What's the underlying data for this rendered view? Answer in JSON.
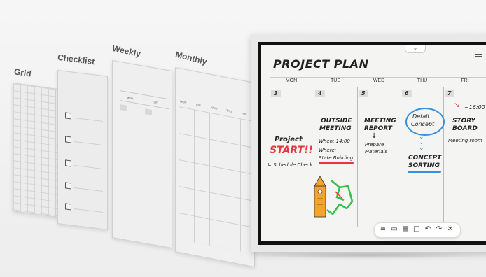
{
  "templates": [
    {
      "label": "Grid"
    },
    {
      "label": "Checklist"
    },
    {
      "label": "Weekly"
    },
    {
      "label": "Monthly"
    }
  ],
  "weekly_days": [
    "MON",
    "TUE"
  ],
  "monthly_days": [
    "MON",
    "TUE",
    "WED",
    "THU",
    "FRI"
  ],
  "board": {
    "title": "PROJECT PLAN",
    "days": [
      "MON",
      "TUE",
      "WED",
      "THU",
      "FRI"
    ],
    "dates": [
      "3",
      "4",
      "5",
      "6",
      "7"
    ],
    "mon": {
      "line1": "Project",
      "line2": "START!!",
      "line3": "Schedule Check"
    },
    "tue": {
      "line1": "OUTSIDE",
      "line2": "MEETING",
      "line3": "When: 14:00",
      "line4": "Where:",
      "line5": "State Building"
    },
    "wed": {
      "line1": "MEETING",
      "line2": "REPORT",
      "line3": "Prepare",
      "line4": "Materials"
    },
    "thu": {
      "line1": "Detail",
      "line2": "Concept",
      "line3": "CONCEPT",
      "line4": "SORTING"
    },
    "fri": {
      "line1": "16:00",
      "line2": "STORY",
      "line3": "BOARD",
      "line4": "Meeting room"
    }
  },
  "toolbar_tools": [
    "menu-icon",
    "note-icon",
    "clipboard-icon",
    "square-icon",
    "undo-icon",
    "redo-icon",
    "close-icon"
  ],
  "toolbar_glyphs": [
    "≡",
    "▭",
    "▤",
    "□",
    "↶",
    "↷",
    "✕"
  ],
  "colors": {
    "accent_red": "#e03a3e",
    "accent_blue": "#3a8fd8",
    "map_green": "#35c04a",
    "building_orange": "#f2a52a"
  }
}
